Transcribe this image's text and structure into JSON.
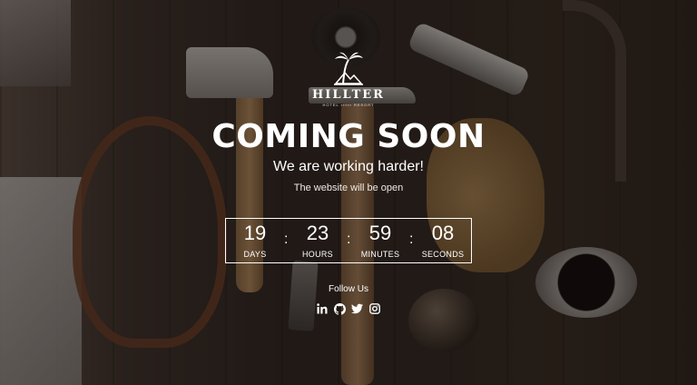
{
  "brand": {
    "name": "HILLTER",
    "tagline": "HOTEL ▪▪▪▪▪ RESORT"
  },
  "hero": {
    "headline": "COMING SOON",
    "subheadline": "We are working harder!",
    "note": "The website will be open"
  },
  "countdown": {
    "units": [
      {
        "value": "19",
        "label": "DAYS"
      },
      {
        "value": "23",
        "label": "HOURS"
      },
      {
        "value": "59",
        "label": "MINUTES"
      },
      {
        "value": "08",
        "label": "SECONDS"
      }
    ],
    "separator": ":"
  },
  "social": {
    "label": "Follow Us",
    "icons": [
      "linkedin-icon",
      "github-icon",
      "twitter-icon",
      "instagram-icon"
    ]
  },
  "colors": {
    "text": "#ffffff",
    "overlay": "#140e0a"
  }
}
